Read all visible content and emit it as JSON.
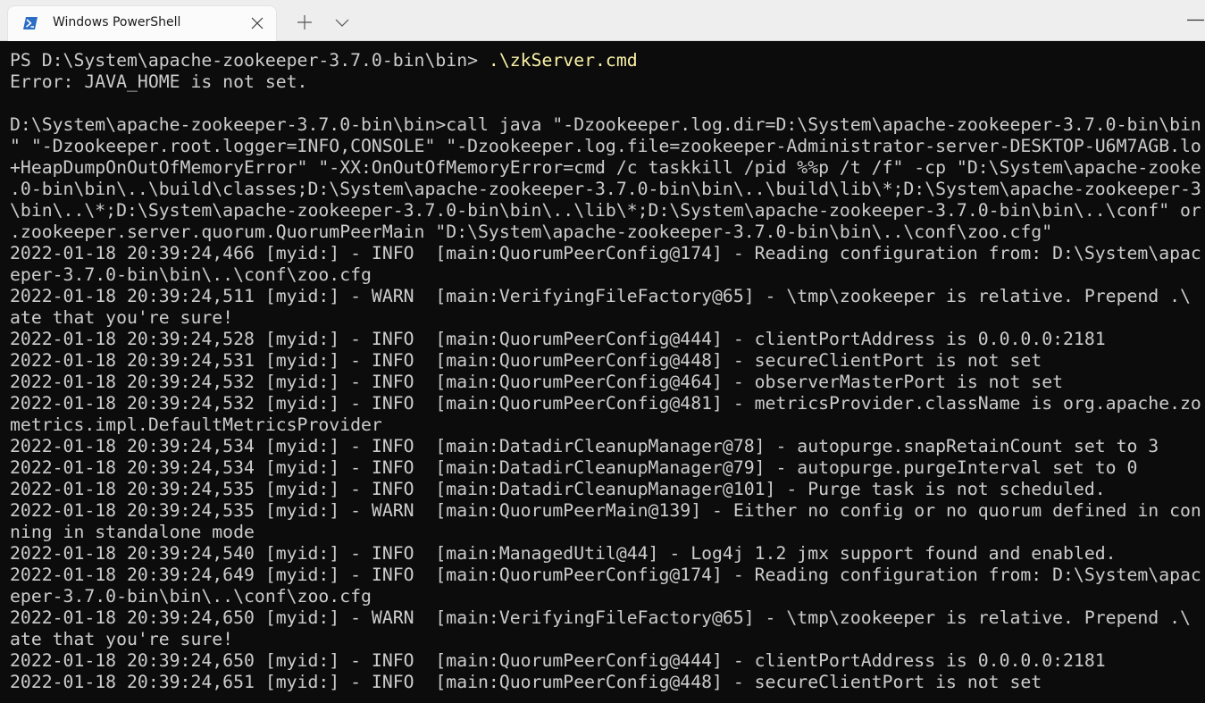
{
  "window": {
    "tab_title": "Windows PowerShell"
  },
  "icons": {
    "tab_icon": "powershell-icon",
    "tab_close": "close-icon",
    "new_tab": "plus-icon",
    "dropdown": "chevron-down-icon",
    "minimize": "minimize-icon"
  },
  "colors": {
    "terminal_background": "#0c0c0c",
    "terminal_text": "#cccccc",
    "command_text": "#f9f1a5",
    "titlebar_background": "#eeeeee",
    "tab_background": "#fbfbfb"
  },
  "terminal": {
    "prompt": "PS D:\\System\\apache-zookeeper-3.7.0-bin\\bin> ",
    "command": ".\\zkServer.cmd",
    "lines": [
      "Error: JAVA_HOME is not set.",
      "",
      "D:\\System\\apache-zookeeper-3.7.0-bin\\bin>call java \"-Dzookeeper.log.dir=D:\\System\\apache-zookeeper-3.7.0-bin\\bin",
      "\" \"-Dzookeeper.root.logger=INFO,CONSOLE\" \"-Dzookeeper.log.file=zookeeper-Administrator-server-DESKTOP-U6M7AGB.lo",
      "+HeapDumpOnOutOfMemoryError\" \"-XX:OnOutOfMemoryError=cmd /c taskkill /pid %%p /t /f\" -cp \"D:\\System\\apache-zooke",
      ".0-bin\\bin\\..\\build\\classes;D:\\System\\apache-zookeeper-3.7.0-bin\\bin\\..\\build\\lib\\*;D:\\System\\apache-zookeeper-3",
      "\\bin\\..\\*;D:\\System\\apache-zookeeper-3.7.0-bin\\bin\\..\\lib\\*;D:\\System\\apache-zookeeper-3.7.0-bin\\bin\\..\\conf\" or",
      ".zookeeper.server.quorum.QuorumPeerMain \"D:\\System\\apache-zookeeper-3.7.0-bin\\bin\\..\\conf\\zoo.cfg\"",
      "2022-01-18 20:39:24,466 [myid:] - INFO  [main:QuorumPeerConfig@174] - Reading configuration from: D:\\System\\apac",
      "eper-3.7.0-bin\\bin\\..\\conf\\zoo.cfg",
      "2022-01-18 20:39:24,511 [myid:] - WARN  [main:VerifyingFileFactory@65] - \\tmp\\zookeeper is relative. Prepend .\\",
      "ate that you're sure!",
      "2022-01-18 20:39:24,528 [myid:] - INFO  [main:QuorumPeerConfig@444] - clientPortAddress is 0.0.0.0:2181",
      "2022-01-18 20:39:24,531 [myid:] - INFO  [main:QuorumPeerConfig@448] - secureClientPort is not set",
      "2022-01-18 20:39:24,532 [myid:] - INFO  [main:QuorumPeerConfig@464] - observerMasterPort is not set",
      "2022-01-18 20:39:24,532 [myid:] - INFO  [main:QuorumPeerConfig@481] - metricsProvider.className is org.apache.zo",
      "metrics.impl.DefaultMetricsProvider",
      "2022-01-18 20:39:24,534 [myid:] - INFO  [main:DatadirCleanupManager@78] - autopurge.snapRetainCount set to 3",
      "2022-01-18 20:39:24,534 [myid:] - INFO  [main:DatadirCleanupManager@79] - autopurge.purgeInterval set to 0",
      "2022-01-18 20:39:24,535 [myid:] - INFO  [main:DatadirCleanupManager@101] - Purge task is not scheduled.",
      "2022-01-18 20:39:24,535 [myid:] - WARN  [main:QuorumPeerMain@139] - Either no config or no quorum defined in con",
      "ning in standalone mode",
      "2022-01-18 20:39:24,540 [myid:] - INFO  [main:ManagedUtil@44] - Log4j 1.2 jmx support found and enabled.",
      "2022-01-18 20:39:24,649 [myid:] - INFO  [main:QuorumPeerConfig@174] - Reading configuration from: D:\\System\\apac",
      "eper-3.7.0-bin\\bin\\..\\conf\\zoo.cfg",
      "2022-01-18 20:39:24,650 [myid:] - WARN  [main:VerifyingFileFactory@65] - \\tmp\\zookeeper is relative. Prepend .\\",
      "ate that you're sure!",
      "2022-01-18 20:39:24,650 [myid:] - INFO  [main:QuorumPeerConfig@444] - clientPortAddress is 0.0.0.0:2181",
      "2022-01-18 20:39:24,651 [myid:] - INFO  [main:QuorumPeerConfig@448] - secureClientPort is not set"
    ]
  }
}
